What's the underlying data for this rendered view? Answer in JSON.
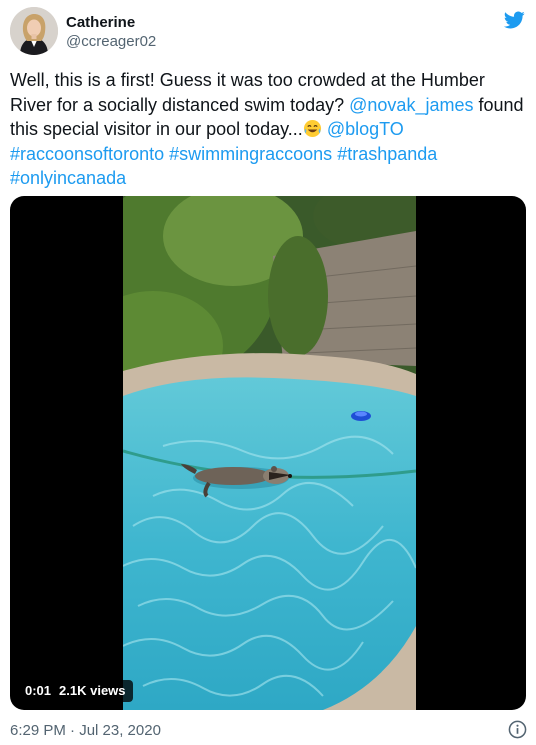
{
  "author": {
    "display_name": "Catherine",
    "handle": "@ccreager02"
  },
  "icons": {
    "brand": "twitter-bird-icon",
    "avatar": "profile-photo",
    "emoji": "face-with-tears-of-joy",
    "info": "info-circle-icon"
  },
  "tweet": {
    "text_part1": "Well, this is a first! Guess it was too crowded at the Humber River for a socially distanced swim today? ",
    "mention_1": "@novak_james",
    "text_part2": " found this special visitor in our pool today...",
    "mention_2": "@blogTO",
    "hashtags": [
      "#raccoonsoftoronto",
      "#swimmingraccoons",
      "#trashpanda",
      "#onlyincanada"
    ]
  },
  "video": {
    "elapsed": "0:01",
    "views": "2.1K views"
  },
  "timestamp": "6:29 PM · Jul 23, 2020",
  "colors": {
    "link": "#1d9bf0",
    "text": "#0f1419",
    "secondary": "#536471",
    "pool_water": "#4fc3d6"
  }
}
